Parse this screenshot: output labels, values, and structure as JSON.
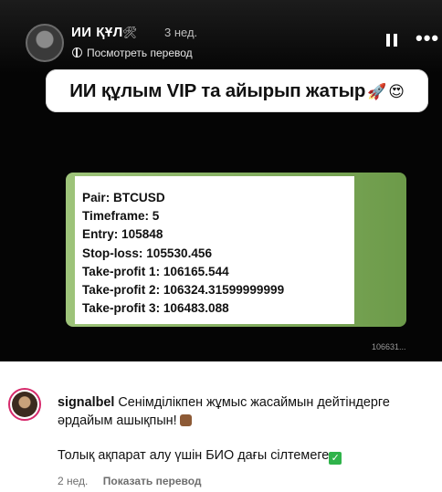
{
  "video": {
    "username": "ИИ ҚҰЛ",
    "badge_emoji": "🛠",
    "time_ago": "3 нед.",
    "translate_label": "Посмотреть перевод",
    "banner_text": "ИИ құлым VIP та айырып жатыр",
    "banner_emoji_1": "🚀",
    "banner_emoji_2": "😍",
    "signal_lines": [
      "Pair: BTCUSD",
      "Timeframe: 5",
      "Entry: 105848",
      "Stop-loss: 105530.456",
      "Take-profit 1: 106165.544",
      "Take-profit 2: 106324.31599999999",
      "Take-profit 3: 106483.088"
    ],
    "frame_code": "106631..."
  },
  "comment": {
    "username": "signalbel",
    "text_line1": "Сенімділікпен жұмыс жасаймын дейтіндерге",
    "text_line2": "әрдайым ашықпын!",
    "text_line3": "Толық ақпарат алу үшін БИО дағы сілтемеге",
    "check_glyph": "✓",
    "time_ago": "2 нед.",
    "show_translation_label": "Показать перевод"
  },
  "colors": {
    "frame_green": "#7fae5a",
    "video_background": "#050505",
    "story_ring": "#d6296b"
  },
  "icons": [
    "pause-icon",
    "more-icon",
    "globe-icon"
  ]
}
